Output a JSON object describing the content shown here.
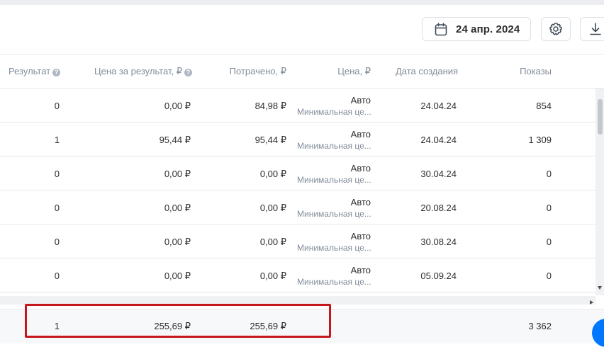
{
  "toolbar": {
    "date_label": "24 апр. 2024"
  },
  "table": {
    "headers": {
      "result": "Результат",
      "cost_per_result": "Цена за результат, ₽",
      "spent": "Потрачено, ₽",
      "price": "Цена, ₽",
      "created": "Дата создания",
      "impressions": "Показы"
    },
    "rows": [
      {
        "result": "0",
        "cost_per_result": "0,00 ₽",
        "spent": "84,98 ₽",
        "price": "Авто",
        "price_sub": "Минимальная це...",
        "created": "24.04.24",
        "impressions": "854"
      },
      {
        "result": "1",
        "cost_per_result": "95,44 ₽",
        "spent": "95,44 ₽",
        "price": "Авто",
        "price_sub": "Минимальная це...",
        "created": "24.04.24",
        "impressions": "1 309"
      },
      {
        "result": "0",
        "cost_per_result": "0,00 ₽",
        "spent": "0,00 ₽",
        "price": "Авто",
        "price_sub": "Минимальная це...",
        "created": "30.04.24",
        "impressions": "0"
      },
      {
        "result": "0",
        "cost_per_result": "0,00 ₽",
        "spent": "0,00 ₽",
        "price": "Авто",
        "price_sub": "Минимальная це...",
        "created": "20.08.24",
        "impressions": "0"
      },
      {
        "result": "0",
        "cost_per_result": "0,00 ₽",
        "spent": "0,00 ₽",
        "price": "Авто",
        "price_sub": "Минимальная це...",
        "created": "30.08.24",
        "impressions": "0"
      },
      {
        "result": "0",
        "cost_per_result": "0,00 ₽",
        "spent": "0,00 ₽",
        "price": "Авто",
        "price_sub": "Минимальная це...",
        "created": "05.09.24",
        "impressions": "0"
      }
    ],
    "totals": {
      "result": "1",
      "cost_per_result": "255,69 ₽",
      "spent": "255,69 ₽",
      "impressions": "3 362"
    }
  },
  "colors": {
    "highlight_border": "#c8171a",
    "accent": "#0077ff"
  }
}
